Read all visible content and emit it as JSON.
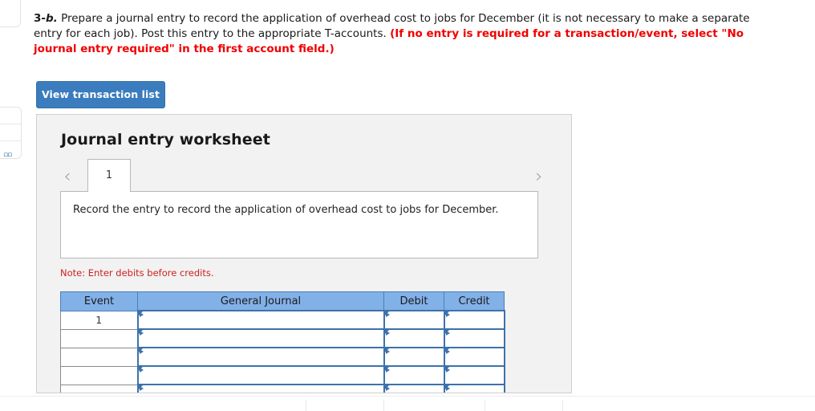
{
  "question": {
    "number_prefix": "3-",
    "number_italic": "b.",
    "body": " Prepare a journal entry to record the application of overhead cost to jobs for December (it is not necessary to make a separate entry for each job). Post this entry to the appropriate T-accounts. ",
    "red_note": "(If no entry is required for a transaction/event, select \"No journal entry required\" in the first account field.)"
  },
  "toolbar": {
    "view_transaction_list_label": "View transaction list"
  },
  "worksheet": {
    "title": "Journal entry worksheet",
    "prev_chevron": "‹",
    "next_chevron": "›",
    "tabs": [
      {
        "label": "1",
        "active": true
      }
    ],
    "instruction": "Record the entry to record the application of overhead cost to jobs for December.",
    "note": "Note: Enter debits before credits."
  },
  "journal_table": {
    "columns": [
      "Event",
      "General Journal",
      "Debit",
      "Credit"
    ],
    "rows": [
      {
        "event": "1",
        "general_journal": "",
        "debit": "",
        "credit": ""
      },
      {
        "event": "",
        "general_journal": "",
        "debit": "",
        "credit": ""
      },
      {
        "event": "",
        "general_journal": "",
        "debit": "",
        "credit": ""
      },
      {
        "event": "",
        "general_journal": "",
        "debit": "",
        "credit": ""
      },
      {
        "event": "",
        "general_journal": "",
        "debit": "",
        "credit": ""
      }
    ]
  },
  "colors": {
    "button_blue": "#3a7cbe",
    "table_header_blue": "#82b1e8",
    "input_border_blue": "#3d72ab",
    "note_red": "#cc2222",
    "alert_red": "#f00000",
    "panel_gray": "#f2f2f2"
  }
}
